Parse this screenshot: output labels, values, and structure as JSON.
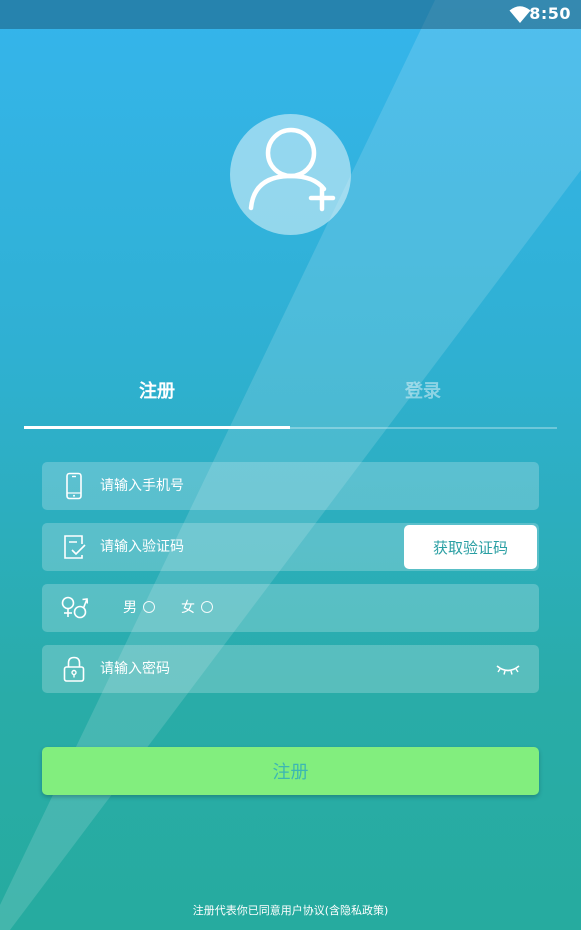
{
  "status_bar": {
    "time": "8:50",
    "wifi_icon": "wifi-icon"
  },
  "avatar": {
    "icon": "add-user-icon"
  },
  "tabs": [
    {
      "label": "注册",
      "active": true
    },
    {
      "label": "登录",
      "active": false
    }
  ],
  "form": {
    "phone": {
      "placeholder": "请输入手机号",
      "value": "",
      "icon": "phone-icon"
    },
    "code": {
      "placeholder": "请输入验证码",
      "value": "",
      "icon": "verify-code-icon",
      "button_label": "获取验证码"
    },
    "gender": {
      "icon": "gender-icon",
      "options": [
        {
          "label": "男",
          "selected": false
        },
        {
          "label": "女",
          "selected": false
        }
      ]
    },
    "password": {
      "placeholder": "请输入密码",
      "value": "",
      "icon": "lock-icon",
      "toggle_icon": "eye-closed-icon"
    }
  },
  "submit_label": "注册",
  "agreement_text": "注册代表你已同意用户协议(含隐私政策)",
  "colors": {
    "background_top": "#35b5ec",
    "background_bottom": "#26ab9f",
    "submit_button": "#82ee7e",
    "submit_text": "#3cb7b3",
    "code_button_text": "#2a9fa3"
  }
}
